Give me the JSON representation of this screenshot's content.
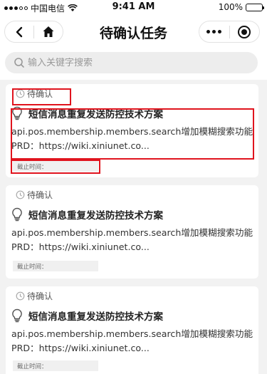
{
  "status_bar": {
    "carrier": "中国电信",
    "time": "9:41 AM",
    "battery": "100%",
    "battery_level": 1.0
  },
  "nav": {
    "title": "待确认任务",
    "back_icon": "back-arrow-icon",
    "home_icon": "home-icon",
    "more_icon": "more-dots-icon",
    "close_icon": "target-close-icon"
  },
  "search": {
    "placeholder": "输入关键字搜索",
    "value": ""
  },
  "cards": [
    {
      "status": "待确认",
      "title": "短信消息重复发送防控技术方案",
      "description": "api.pos.membership.members.search增加模糊搜索功能 PRD：https://wiki.xiniunet.co...",
      "deadline_label": "截止时间："
    },
    {
      "status": "待确认",
      "title": "短信消息重复发送防控技术方案",
      "description": "api.pos.membership.members.search增加模糊搜索功能 PRD：https://wiki.xiniunet.co...",
      "deadline_label": "截止时间："
    },
    {
      "status": "待确认",
      "title": "短信消息重复发送防控技术方案",
      "description": "api.pos.membership.members.search增加模糊搜索功能 PRD：https://wiki.xiniunet.co...",
      "deadline_label": "截止时间："
    }
  ],
  "colors": {
    "highlight": "#e0141e",
    "background": "#f2f2f2",
    "card": "#ffffff"
  }
}
